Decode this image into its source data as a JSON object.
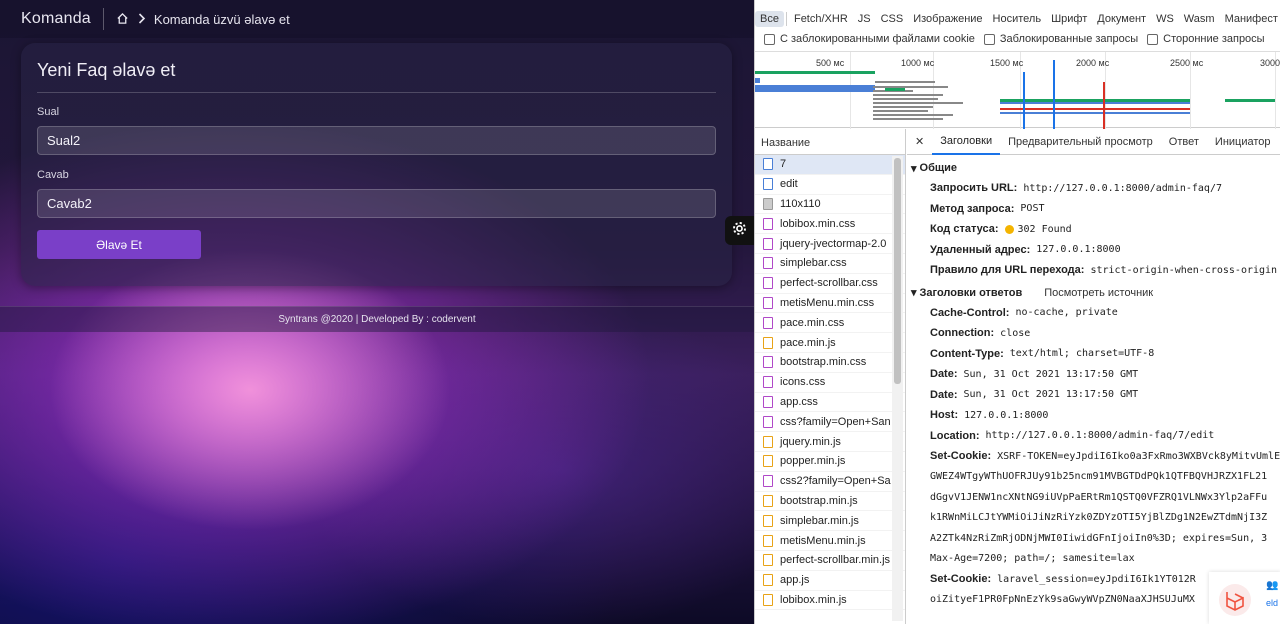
{
  "app": {
    "brand": "Komanda",
    "breadcrumb_current": "Komanda üzvü əlavə et",
    "card_title": "Yeni Faq əlavə et",
    "fields": [
      {
        "label": "Sual",
        "value": "Sual2"
      },
      {
        "label": "Cavab",
        "value": "Cavab2"
      }
    ],
    "submit_label": "Əlavə Et",
    "footer": "Syntrans @2020 | Developed By : codervent"
  },
  "devtools": {
    "filters": [
      "Все",
      "Fetch/XHR",
      "JS",
      "CSS",
      "Изображение",
      "Носитель",
      "Шрифт",
      "Документ",
      "WS",
      "Wasm",
      "Манифест"
    ],
    "checkboxes": [
      "С заблокированными файлами cookie",
      "Заблокированные запросы",
      "Сторонние запросы"
    ],
    "timeline_ticks": [
      "500 мс",
      "1000 мс",
      "1500 мс",
      "2000 мс",
      "2500 мс",
      "3000"
    ],
    "name_header": "Название",
    "files": [
      {
        "name": "7",
        "type": "doc"
      },
      {
        "name": "edit",
        "type": "doc"
      },
      {
        "name": "110x110",
        "type": "img"
      },
      {
        "name": "lobibox.min.css",
        "type": "css"
      },
      {
        "name": "jquery-jvectormap-2.0",
        "type": "css"
      },
      {
        "name": "simplebar.css",
        "type": "css"
      },
      {
        "name": "perfect-scrollbar.css",
        "type": "css"
      },
      {
        "name": "metisMenu.min.css",
        "type": "css"
      },
      {
        "name": "pace.min.css",
        "type": "css"
      },
      {
        "name": "pace.min.js",
        "type": "js"
      },
      {
        "name": "bootstrap.min.css",
        "type": "css"
      },
      {
        "name": "icons.css",
        "type": "css"
      },
      {
        "name": "app.css",
        "type": "css"
      },
      {
        "name": "css?family=Open+San",
        "type": "css"
      },
      {
        "name": "jquery.min.js",
        "type": "js"
      },
      {
        "name": "popper.min.js",
        "type": "js"
      },
      {
        "name": "css2?family=Open+Sa",
        "type": "css"
      },
      {
        "name": "bootstrap.min.js",
        "type": "js"
      },
      {
        "name": "simplebar.min.js",
        "type": "js"
      },
      {
        "name": "metisMenu.min.js",
        "type": "js"
      },
      {
        "name": "perfect-scrollbar.min.js",
        "type": "js"
      },
      {
        "name": "app.js",
        "type": "js"
      },
      {
        "name": "lobibox.min.js",
        "type": "js"
      }
    ],
    "tabs": [
      "Заголовки",
      "Предварительный просмотр",
      "Ответ",
      "Инициатор"
    ],
    "general_title": "Общие",
    "general": [
      {
        "k": "Запросить URL:",
        "v": "http://127.0.0.1:8000/admin-faq/7"
      },
      {
        "k": "Метод запроса:",
        "v": "POST"
      },
      {
        "k": "Код статуса:",
        "v": "302 Found"
      },
      {
        "k": "Удаленный адрес:",
        "v": "127.0.0.1:8000"
      },
      {
        "k": "Правило для URL перехода:",
        "v": "strict-origin-when-cross-origin"
      }
    ],
    "resp_title": "Заголовки ответов",
    "view_source": "Посмотреть источник",
    "resp": [
      {
        "k": "Cache-Control:",
        "v": "no-cache, private"
      },
      {
        "k": "Connection:",
        "v": "close"
      },
      {
        "k": "Content-Type:",
        "v": "text/html; charset=UTF-8"
      },
      {
        "k": "Date:",
        "v": "Sun, 31 Oct 2021 13:17:50 GMT"
      },
      {
        "k": "Date:",
        "v": "Sun, 31 Oct 2021 13:17:50 GMT"
      },
      {
        "k": "Host:",
        "v": "127.0.0.1:8000"
      },
      {
        "k": "Location:",
        "v": "http://127.0.0.1:8000/admin-faq/7/edit"
      },
      {
        "k": "Set-Cookie:",
        "v": "XSRF-TOKEN=eyJpdiI6Iko0a3FxRmo3WXBVck8yMitvUmlE"
      }
    ],
    "cookie_cont": [
      "GWEZ4WTgyWThUOFRJUy91b25ncm91MVBGTDdPQk1QTFBQVHJRZX1FL21",
      "dGgvV1JENW1ncXNtNG9iUVpPaERtRm1QSTQ0VFZRQ1VLNWx3Ylp2aFFu",
      "k1RWnMiLCJtYWMiOiJiNzRiYzk0ZDYzOTI5YjBlZDg1N2EwZTdmNjI3Z",
      "A2ZTk4NzRiZmRjODNjMWI0IiwidGFnIjoiIn0%3D; expires=Sun, 3",
      "Max-Age=7200; path=/; samesite=lax"
    ],
    "set_cookie2_k": "Set-Cookie:",
    "set_cookie2_v": "laravel_session=eyJpdiI6Ik1YT012R",
    "cookie2_cont": "oiZityeF1PR0FpNnEzYk9saGwyWVpZN0NaaXJHSUJuMX",
    "laravel_label": "eld"
  }
}
